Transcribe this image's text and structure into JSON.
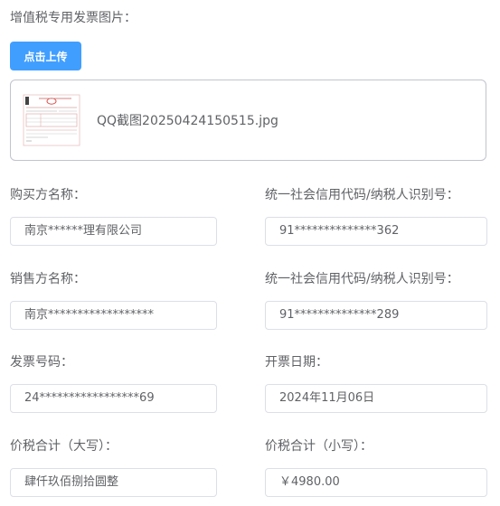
{
  "upload": {
    "title": "增值税专用发票图片：",
    "button_label": "点击上传",
    "file_name": "QQ截图20250424150515.jpg"
  },
  "buyer": {
    "name_label": "购买方名称：",
    "name_value": "南京******理有限公司",
    "code_label": "统一社会信用代码/纳税人识别号：",
    "code_value": "91**************362"
  },
  "seller": {
    "name_label": "销售方名称：",
    "name_value": "南京******************",
    "code_label": "统一社会信用代码/纳税人识别号：",
    "code_value": "91**************289"
  },
  "invoice": {
    "number_label": "发票号码：",
    "number_value": "24*****************69",
    "date_label": "开票日期：",
    "date_value": "2024年11月06日"
  },
  "total": {
    "upper_label": "价税合计（大写）：",
    "upper_value": "肆仟玖佰捌拾圆整",
    "lower_label": "价税合计（小写）：",
    "lower_value": "￥4980.00"
  },
  "colors": {
    "primary": "#409eff",
    "text": "#606266",
    "border": "#dcdfe6"
  }
}
